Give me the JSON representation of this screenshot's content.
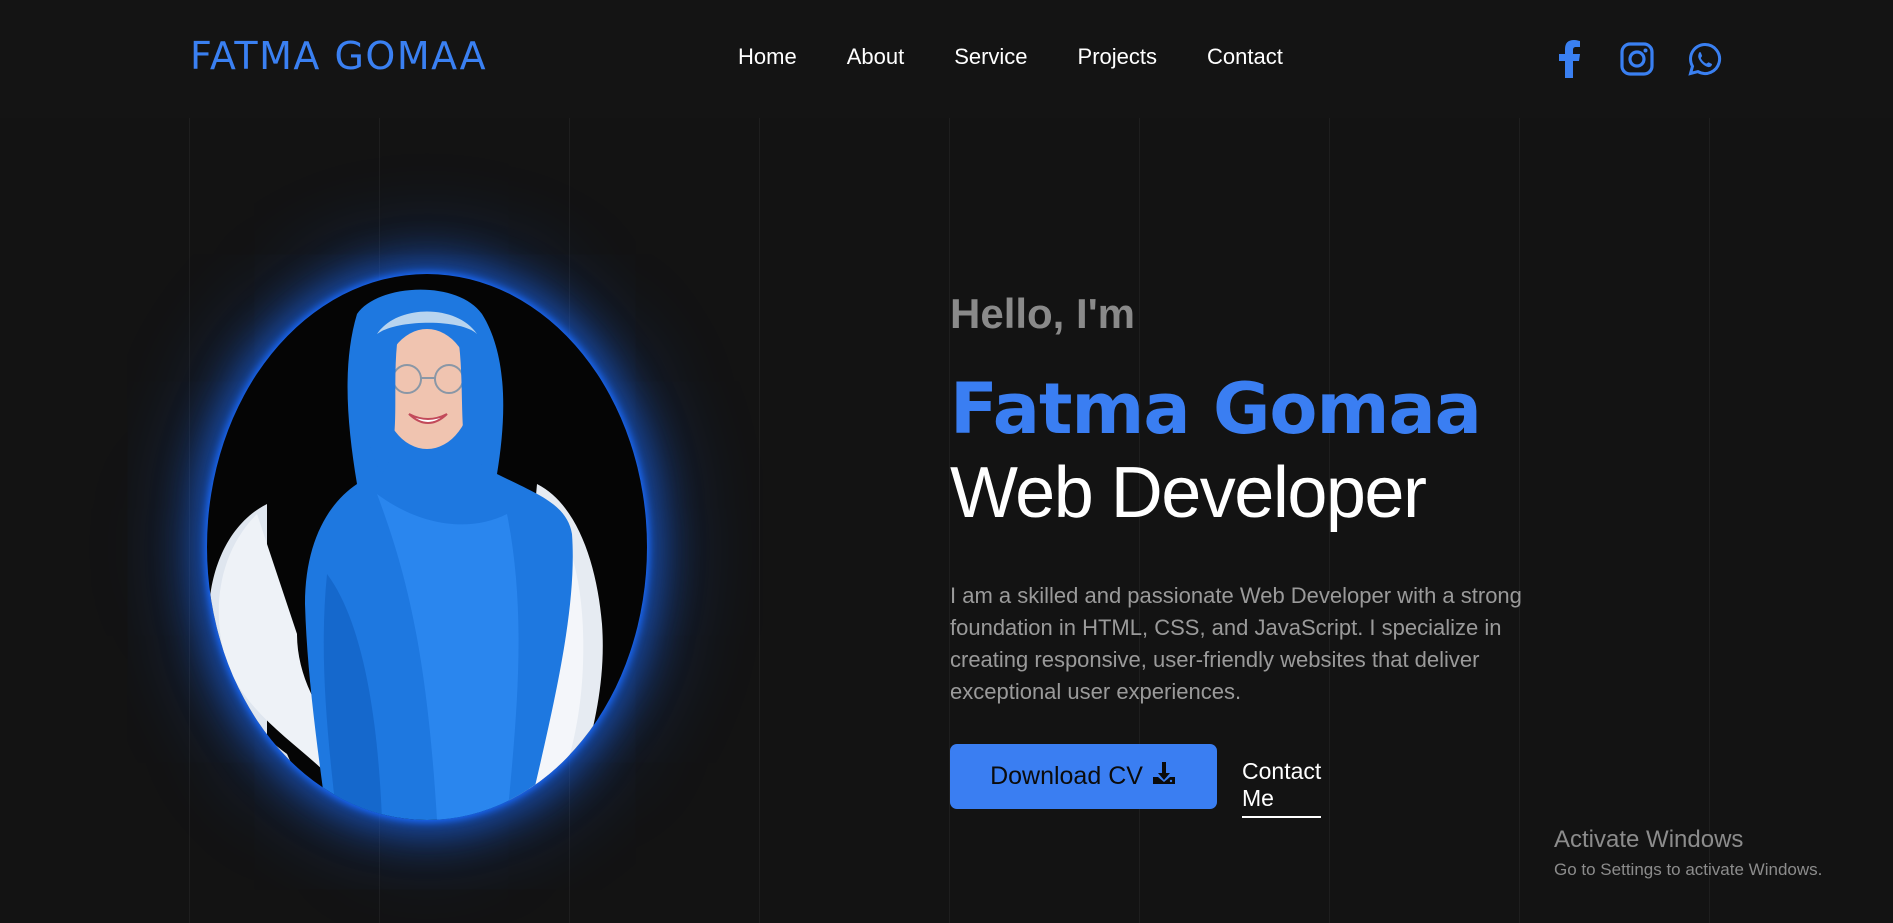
{
  "header": {
    "logo": "FATMA GOMAA",
    "nav": [
      "Home",
      "About",
      "Service",
      "Projects",
      "Contact"
    ],
    "social_icons": [
      "facebook-icon",
      "instagram-icon",
      "whatsapp-icon"
    ]
  },
  "hero": {
    "greeting": "Hello, I'm",
    "name": "Fatma Gomaa",
    "role": "Web Developer",
    "description": "I am a skilled and passionate Web Developer with a strong foundation in HTML, CSS, and JavaScript. I specialize in creating responsive, user-friendly websites that deliver exceptional user experiences.",
    "download_button": "Download CV",
    "contact_link": "Contact Me"
  },
  "watermark": {
    "title": "Activate Windows",
    "subtitle": "Go to Settings to activate Windows."
  },
  "colors": {
    "accent": "#3a7ef2",
    "background": "#131313"
  }
}
